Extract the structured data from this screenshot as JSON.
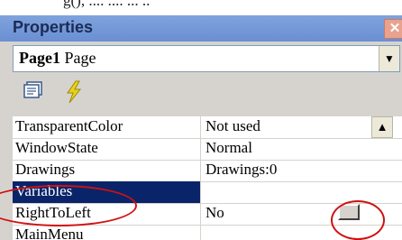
{
  "top_text": "g(),       ....    ....          ...  ..",
  "panel": {
    "title": "Properties",
    "close_glyph": "✕"
  },
  "object": {
    "name": "Page1",
    "type": "Page"
  },
  "toolbar": {
    "properties_icon": "property-pages-icon",
    "events_icon": "lightning-icon"
  },
  "rows": [
    {
      "name": "TransparentColor",
      "value": "Not used"
    },
    {
      "name": "WindowState",
      "value": "Normal"
    },
    {
      "name": "Drawings",
      "value": "Drawings:0"
    },
    {
      "name": "Variables",
      "value": ""
    },
    {
      "name": "RightToLeft",
      "value": "No"
    },
    {
      "name": "MainMenu",
      "value": ""
    }
  ],
  "selected_row": "Variables",
  "colors": {
    "selection": "#0a246a",
    "annotation": "#d01010",
    "titlebar": "#7fa3dc"
  }
}
